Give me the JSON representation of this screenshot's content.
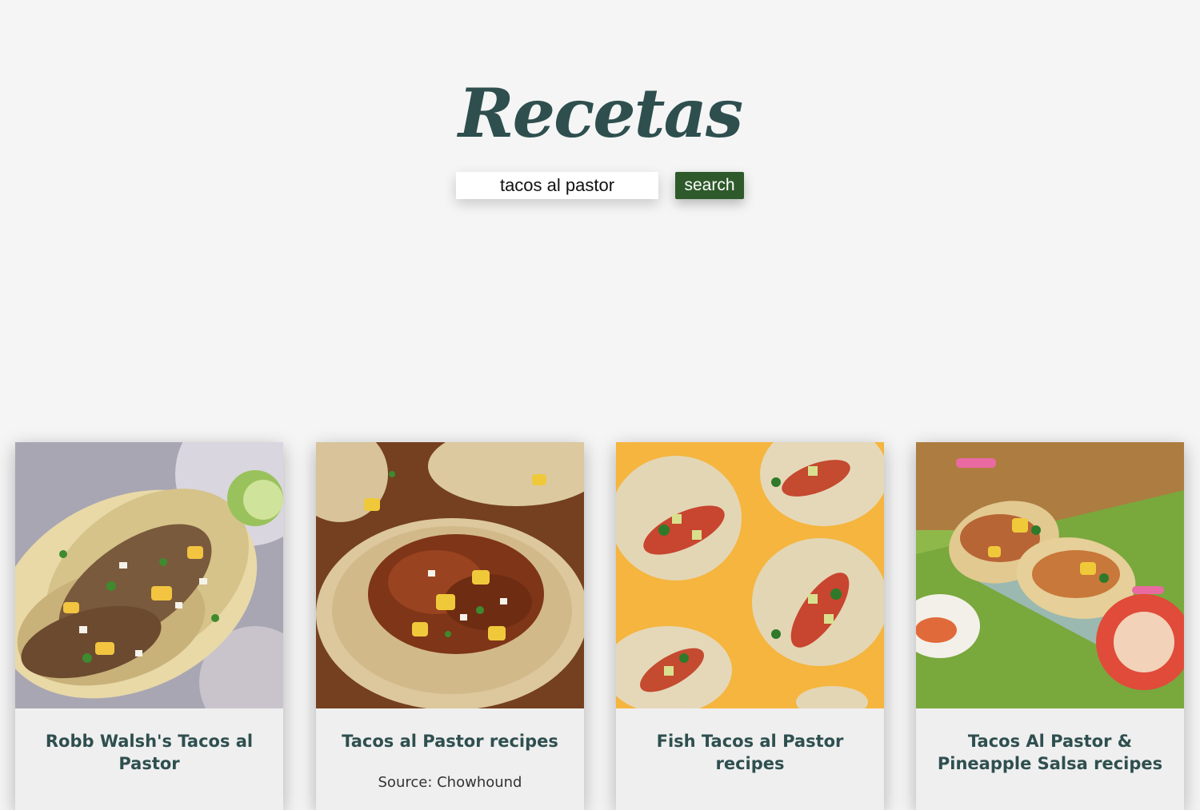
{
  "header": {
    "logo_text": "Recetas",
    "search": {
      "value": "tacos al pastor",
      "button_label": "search"
    }
  },
  "results": [
    {
      "title": "Robb Walsh's Tacos al Pastor",
      "source": "",
      "image_icon": "tacos-plate-photo"
    },
    {
      "title": "Tacos al Pastor recipes",
      "source": "Source: Chowhound",
      "image_icon": "pastor-taco-wood-photo"
    },
    {
      "title": "Fish Tacos al Pastor recipes",
      "source": "",
      "image_icon": "fish-tacos-yellow-photo"
    },
    {
      "title": "Tacos Al Pastor & Pineapple Salsa recipes",
      "source": "",
      "image_icon": "tacos-holder-green-photo"
    }
  ],
  "colors": {
    "background": "#f5f5f5",
    "brand": "#2f4f4f",
    "button": "#2e5a2b"
  }
}
